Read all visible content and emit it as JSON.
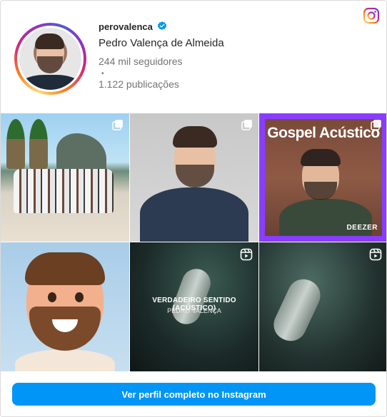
{
  "profile": {
    "username": "perovalenca",
    "full_name": "Pedro Valença de Almeida",
    "followers": "244 mil seguidores",
    "separator": "•",
    "posts": "1.122 publicações",
    "verified": true
  },
  "grid": {
    "tiles": [
      {
        "type": "carousel"
      },
      {
        "type": "carousel"
      },
      {
        "type": "carousel",
        "title": "Gospel Acústico",
        "brand": "DEEZER"
      },
      {
        "type": "image"
      },
      {
        "type": "reel",
        "title": "VERDADEIRO SENTIDO (ACÚSTICO)",
        "subtitle": "PEDRO VALENÇA"
      },
      {
        "type": "reel"
      }
    ]
  },
  "footer": {
    "cta_label": "Ver perfil completo no Instagram"
  },
  "colors": {
    "accent": "#0095f6",
    "verified": "#0095f6",
    "tile3_border": "#8b3dff"
  }
}
